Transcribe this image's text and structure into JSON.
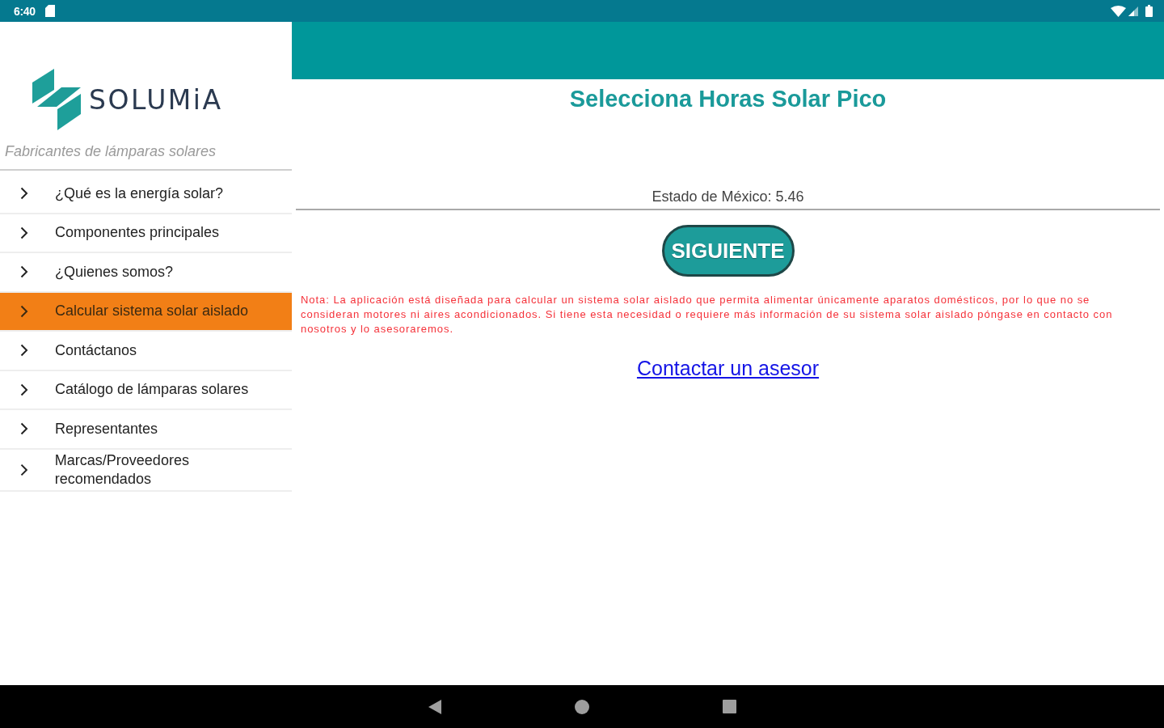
{
  "status_bar": {
    "time": "6:40"
  },
  "drawer": {
    "logo_text": "SOLUMiA",
    "tagline": "Fabricantes de lámparas solares",
    "items": [
      {
        "label": "¿Qué es la energía solar?",
        "selected": false
      },
      {
        "label": "Componentes principales",
        "selected": false
      },
      {
        "label": "¿Quienes somos?",
        "selected": false
      },
      {
        "label": "Calcular sistema solar aislado",
        "selected": true
      },
      {
        "label": "Contáctanos",
        "selected": false
      },
      {
        "label": "Catálogo de lámparas solares",
        "selected": false
      },
      {
        "label": "Representantes",
        "selected": false
      },
      {
        "label": "Marcas/Proveedores recomendados",
        "selected": false
      }
    ]
  },
  "main": {
    "title": "Selecciona Horas Solar Pico",
    "selector": {
      "value": "Estado de México: 5.46"
    },
    "next_button": "SIGUIENTE",
    "note": "Nota: La aplicación está diseñada para calcular un sistema solar aislado que permita alimentar únicamente aparatos domésticos, por lo que no se consideran motores ni aires acondicionados. Si tiene esta necesidad o requiere más información de su sistema solar aislado póngase en contacto con nosotros y lo asesoraremos.",
    "link": "Contactar un asesor"
  }
}
